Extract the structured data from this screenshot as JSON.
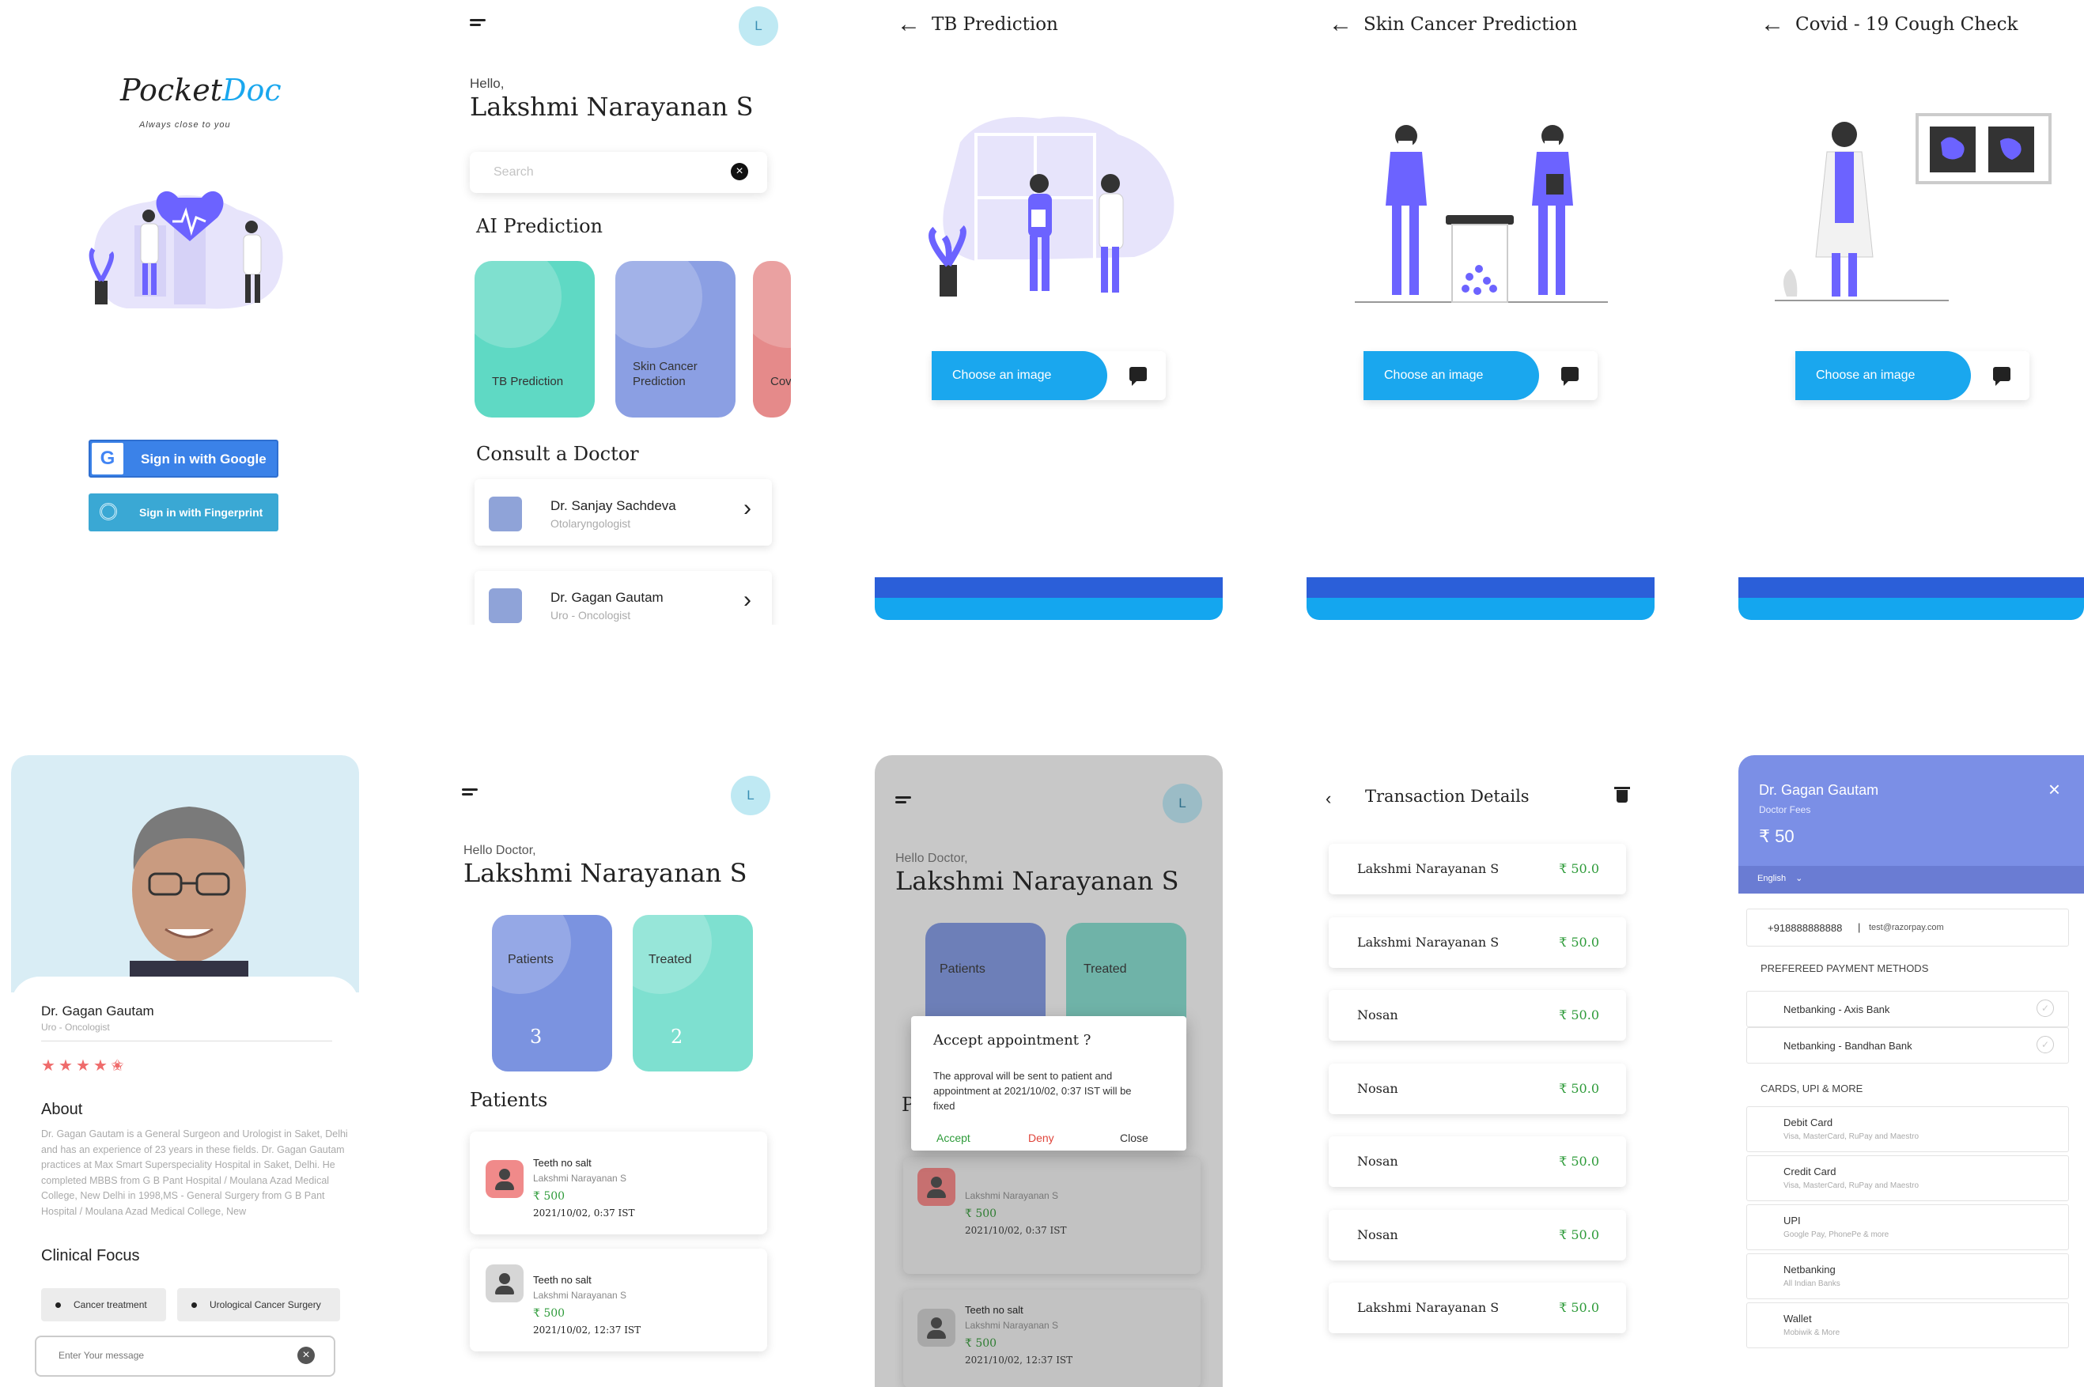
{
  "login": {
    "brand_pocket": "Pocket",
    "brand_doc": "Doc",
    "tagline": "Always close to you",
    "google_btn": "Sign in with Google",
    "fingerprint_btn": "Sign in with Fingerprint"
  },
  "home": {
    "avatar": "L",
    "greeting": "Hello,",
    "name": "Lakshmi Narayanan S",
    "search_placeholder": "Search",
    "ai_title": "AI Prediction",
    "ai_cards": [
      {
        "label": "TB Prediction",
        "color": "#5fd9c4"
      },
      {
        "label": "Skin Cancer Prediction",
        "color": "#8b9fe3"
      },
      {
        "label": "Cov Pre",
        "color": "#e58a8a"
      }
    ],
    "consult_title": "Consult a Doctor",
    "doctors": [
      {
        "name": "Dr. Sanjay Sachdeva",
        "specialty": "Otolaryngologist"
      },
      {
        "name": "Dr. Gagan Gautam",
        "specialty": "Uro - Oncologist"
      }
    ]
  },
  "tb": {
    "title": "TB Prediction",
    "choose": "Choose an image"
  },
  "skin": {
    "title": "Skin Cancer Prediction",
    "choose": "Choose an image"
  },
  "covid": {
    "title": "Covid - 19 Cough Check",
    "choose": "Choose an image"
  },
  "profile": {
    "name": "Dr. Gagan Gautam",
    "specialty": "Uro - Oncologist",
    "rating": 4.5,
    "about_title": "About",
    "about_text": "Dr. Gagan Gautam is a General Surgeon and Urologist in Saket, Delhi and has an experience of 23 years in these fields. Dr. Gagan Gautam practices at Max Smart Superspeciality Hospital in Saket, Delhi. He completed MBBS from G B Pant Hospital / Moulana Azad Medical College, New Delhi in 1998,MS - General Surgery from G B Pant Hospital / Moulana Azad Medical College, New",
    "focus_title": "Clinical Focus",
    "focus": [
      "Cancer treatment",
      "Urological Cancer Surgery"
    ],
    "message_placeholder": "Enter Your message"
  },
  "doctor_home": {
    "avatar": "L",
    "greeting": "Hello Doctor,",
    "name": "Lakshmi Narayanan S",
    "stats": [
      {
        "label": "Patients",
        "value": "3",
        "color": "#7b93e0"
      },
      {
        "label": "Treated",
        "value": "2",
        "color": "#7ee0d0"
      }
    ],
    "patients_title": "Patients",
    "patients": [
      {
        "title": "Teeth no salt",
        "name": "Lakshmi Narayanan S",
        "fee": "₹ 500",
        "time": "2021/10/02, 0:37 IST",
        "icon_color": "#f08a8a"
      },
      {
        "title": "Teeth no salt",
        "name": "Lakshmi Narayanan S",
        "fee": "₹ 500",
        "time": "2021/10/02, 12:37 IST",
        "icon_color": "#d6d6d6"
      }
    ]
  },
  "dialog": {
    "avatar": "L",
    "greeting": "Hello Doctor,",
    "name": "Lakshmi Narayanan S",
    "stats": [
      "Patients",
      "Treated"
    ],
    "patients_letter": "P",
    "title": "Accept appointment ?",
    "body": "The approval will be sent to patient and appointment at 2021/10/02, 0:37 IST will be fixed",
    "accept": "Accept",
    "deny": "Deny",
    "close": "Close",
    "bg_card1": {
      "name": "Lakshmi Narayanan S",
      "fee": "₹ 500",
      "time": "2021/10/02, 0:37 IST"
    },
    "bg_card2": {
      "title": "Teeth no salt",
      "name": "Lakshmi Narayanan S",
      "fee": "₹ 500",
      "time": "2021/10/02, 12:37 IST"
    }
  },
  "transactions": {
    "title": "Transaction Details",
    "rows": [
      {
        "name": "Lakshmi Narayanan S",
        "amount": "₹ 50.0"
      },
      {
        "name": "Lakshmi Narayanan S",
        "amount": "₹ 50.0"
      },
      {
        "name": "Nosan",
        "amount": "₹ 50.0"
      },
      {
        "name": "Nosan",
        "amount": "₹ 50.0"
      },
      {
        "name": "Nosan",
        "amount": "₹ 50.0"
      },
      {
        "name": "Nosan",
        "amount": "₹ 50.0"
      },
      {
        "name": "Lakshmi Narayanan S",
        "amount": "₹ 50.0"
      }
    ]
  },
  "payment": {
    "doctor": "Dr. Gagan Gautam",
    "fee_label": "Doctor Fees",
    "fee": "₹ 50",
    "language": "English",
    "phone": "+918888888888",
    "email": "test@razorpay.com",
    "preferred_title": "PREFEREED PAYMENT METHODS",
    "preferred": [
      "Netbanking - Axis Bank",
      "Netbanking - Bandhan Bank"
    ],
    "cards_title": "CARDS, UPI & MORE",
    "methods": [
      {
        "name": "Debit Card",
        "sub": "Visa, MasterCard, RuPay and Maestro"
      },
      {
        "name": "Credit Card",
        "sub": "Visa, MasterCard, RuPay and Maestro"
      },
      {
        "name": "UPI",
        "sub": "Google Pay, PhonePe & more"
      },
      {
        "name": "Netbanking",
        "sub": "All Indian Banks"
      },
      {
        "name": "Wallet",
        "sub": "Mobiwik & More"
      }
    ]
  },
  "colors": {
    "accent_blue": "#1aa7ee",
    "dark_blue": "#2b5fd9",
    "purple": "#6c63ff",
    "green": "#2e9b3a",
    "red": "#e0443a",
    "pay_header": "#7b8fe6"
  }
}
